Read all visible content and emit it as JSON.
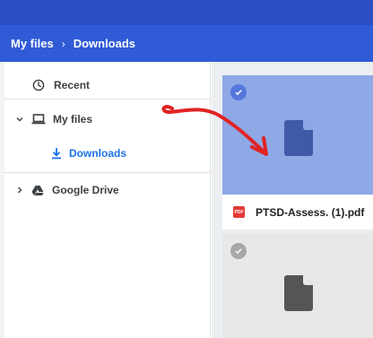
{
  "breadcrumb": {
    "root": "My files",
    "separator": "›",
    "current": "Downloads"
  },
  "sidebar": {
    "items": [
      {
        "label": "Recent",
        "icon": "clock-icon"
      },
      {
        "label": "My files",
        "icon": "laptop-icon",
        "expander": "chevron-down-icon"
      },
      {
        "label": "Downloads",
        "icon": "download-icon"
      },
      {
        "label": "Google Drive",
        "icon": "drive-icon",
        "expander": "chevron-right-icon"
      }
    ]
  },
  "files": [
    {
      "name": "PTSD-Assess. (1).pdf",
      "type_badge": "PDF",
      "selected": true
    },
    {
      "name": "",
      "selected": false
    }
  ],
  "colors": {
    "header": "#2f5bd7",
    "selected_tile": "#8fa8e6",
    "accent": "#1a73e8",
    "annotation": "#e02424"
  }
}
